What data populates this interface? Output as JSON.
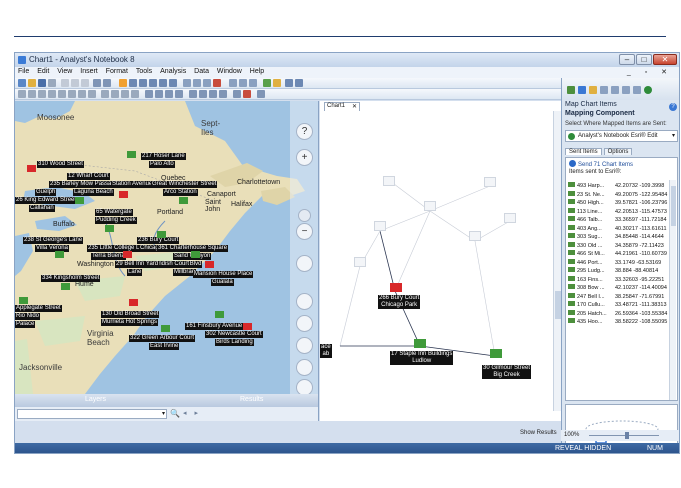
{
  "window": {
    "title": "Chart1 - Analyst's Notebook 8",
    "minimize": "–",
    "maximize": "□",
    "close": "✕"
  },
  "menubar": {
    "items": [
      "File",
      "Edit",
      "View",
      "Insert",
      "Format",
      "Tools",
      "Analysis",
      "Data",
      "Window",
      "Help"
    ],
    "mdi_controls": "_ ▫ ✕"
  },
  "map": {
    "labels": [
      {
        "text": "Moosonee",
        "kind": "big"
      },
      {
        "text": "Sept-Iles",
        "kind": "big"
      },
      {
        "text": "Charlottetown",
        "kind": "plain"
      },
      {
        "text": "Canaport",
        "kind": "plain"
      },
      {
        "text": "Saint John",
        "kind": "plain"
      },
      {
        "text": "Halifax",
        "kind": "plain"
      },
      {
        "text": "Portland",
        "kind": "plain"
      },
      {
        "text": "Quebec",
        "kind": "plain"
      },
      {
        "text": "Buffalo",
        "kind": "plain"
      },
      {
        "text": "Virginia Beach",
        "kind": "big"
      },
      {
        "text": "Jacksonville",
        "kind": "big"
      },
      {
        "text": "Washington",
        "kind": "plain"
      },
      {
        "text": "Hume",
        "kind": "plain"
      }
    ],
    "address_labels": [
      "310 Wood Street",
      "217 Hoser Lane",
      "Palo Alto",
      "12 Wharf Court",
      "235 Barley Mow Passage",
      "Guelph",
      "Laguna Beach",
      "Station Avenue",
      "Great Winchester Street",
      "Arco Station",
      "26 King Edward Street",
      "Callahan",
      "65 Watergate",
      "Pudding Creek",
      "238 St George's Lane",
      "Villa Verona",
      "235 Little College Lane",
      "Terra Buena",
      "236 Bury Court",
      "Chicago Park",
      "361 Charterhouse Square",
      "Sand Canyon",
      "Tustin Blvd",
      "26 Cavendish Court",
      "Millbrae",
      "Mansion House Place",
      "Gualala",
      "334 Kingsholm Street",
      "130 Old Broad Street",
      "Murrieta Hot Springs",
      "161 Finsbury Avenue",
      "302 Newcastle Court",
      "Birds Landing",
      "322 Green Arbour Court",
      "East Irvine",
      "Applegate Street",
      "Rio Nido",
      "Palace",
      "29 Bell Inn Yard",
      "Lane"
    ],
    "tabs": {
      "layers": "Layers",
      "results": "Results"
    },
    "search": {
      "value": "",
      "glass": "🔍",
      "arrows": "◂ ▸"
    },
    "controls": [
      "?",
      "+",
      "−"
    ]
  },
  "chart": {
    "tab_label": "Chart1",
    "tab_close": "✕",
    "nodes": [
      {
        "line1": "266 Bury Court",
        "line2": "Chicago Park"
      },
      {
        "line1": "17 Staple Inn Buildings",
        "line2": "Ludlow"
      },
      {
        "line1": "30 Gilmour Street",
        "line2": "Big Creek"
      },
      {
        "line1": "ace",
        "line2": "ab"
      }
    ],
    "show_results": "Show Results"
  },
  "panel": {
    "title": "Map Chart Items",
    "subtitle": "Mapping Component",
    "help": "?",
    "select_label": "Select Where Mapped Items are Sent:",
    "select_value": "Analyst's Notebook Esri® Edit",
    "tabs": [
      "Sent Items",
      "Options"
    ],
    "send_label": "Send 71 Chart Items",
    "sent_to": "Items sent to Esri®:",
    "rows": [
      {
        "name": "493 Harp...",
        "lat": "42.20732",
        "lon": "-109.3998"
      },
      {
        "name": "23 St. Ne...",
        "lat": "49.20075",
        "lon": "-122.95484"
      },
      {
        "name": "450 High...",
        "lat": "39.57821",
        "lon": "-106.23796"
      },
      {
        "name": "113 Line...",
        "lat": "42.20513",
        "lon": "-115.47573"
      },
      {
        "name": "466 Talb...",
        "lat": "33.36597",
        "lon": "-111.72184"
      },
      {
        "name": "403 Ang...",
        "lat": "40.30217",
        "lon": "-113.61611"
      },
      {
        "name": "303 Sug...",
        "lat": "34.85448",
        "lon": "-114.4644"
      },
      {
        "name": "330 Old ...",
        "lat": "34.35879",
        "lon": "-72.11423"
      },
      {
        "name": "466 St Mi...",
        "lat": "44.21961",
        "lon": "-110.60739"
      },
      {
        "name": "446 Port...",
        "lat": "33.1749",
        "lon": "-63.53169"
      },
      {
        "name": "295 Ludg...",
        "lat": "38.884",
        "lon": "-88.40814"
      },
      {
        "name": "163 Fins...",
        "lat": "33.32603",
        "lon": "-95.22251"
      },
      {
        "name": "308 Bow ...",
        "lat": "42.10237",
        "lon": "-114.40094"
      },
      {
        "name": "247 Bell I...",
        "lat": "38.25847",
        "lon": "-71.67991"
      },
      {
        "name": "170 Cullu...",
        "lat": "33.48721",
        "lon": "-111.38313"
      },
      {
        "name": "205 Hatch...",
        "lat": "26.59364",
        "lon": "-103.55384"
      },
      {
        "name": "435 Hoo...",
        "lat": "38.58222",
        "lon": "-108.55095"
      }
    ],
    "zoom": "100%"
  },
  "status": {
    "reveal": "REVEAL HIDDEN",
    "num": "NUM"
  },
  "colors": {
    "map_water": "#9fc3e2",
    "map_land": "#e9dfb9",
    "status_bar": "#2f5a93",
    "flag_red": "#d8282a",
    "flag_green": "#3f9a3a"
  }
}
